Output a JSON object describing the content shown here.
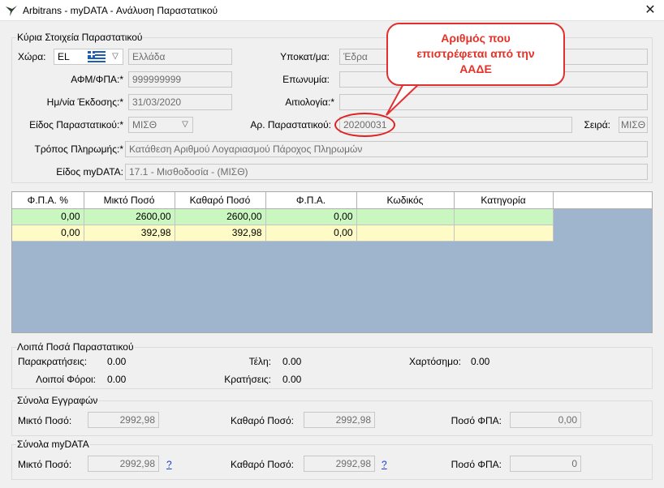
{
  "window": {
    "title": "Arbitrans - myDATA - Ανάλυση Παραστατικού",
    "close_glyph": "✕",
    "app_icon": "bird-logo-icon"
  },
  "main": {
    "group_title": "Κύρια Στοιχεία Παραστατικού",
    "country_label": "Χώρα:",
    "country_code": "EL",
    "country_name": "Ελλάδα",
    "afm_label": "ΑΦΜ/ΦΠΑ:*",
    "afm_value": "999999999",
    "issue_date_label": "Ημ/νία Έκδοσης:*",
    "issue_date_value": "31/03/2020",
    "doc_type_label": "Είδος Παραστατικού:*",
    "doc_type_value": "ΜΙΣΘ",
    "payment_label": "Τρόπος Πληρωμής:*",
    "payment_value": "Κατάθεση Αριθμού Λογαριασμού Πάροχος Πληρωμών",
    "mydata_type_label": "Είδος myDATA:",
    "mydata_type_value": "17.1 - Μισθοδοσία - (ΜΙΣΘ)",
    "branch_label": "Υποκατ/μα:",
    "branch_value": "Έδρα",
    "name_label": "Επωνυμία:",
    "name_value": "",
    "reason_label": "Αιτιολογία:*",
    "reason_value": "",
    "doc_number_label": "Αρ. Παραστατικού:",
    "doc_number_value": "20200031",
    "series_label": "Σειρά:",
    "series_value": "ΜΙΣΘ"
  },
  "callout": {
    "line1": "Αριθμός που",
    "line2": "επιστρέφεται από την",
    "line3": "ΑΑΔΕ",
    "color": "#e53228"
  },
  "grid": {
    "columns": [
      "Φ.Π.Α. %",
      "Μικτό Ποσό",
      "Καθαρό Ποσό",
      "Φ.Π.Α.",
      "Κωδικός",
      "Κατηγορία"
    ],
    "rows": [
      [
        "0,00",
        "2600,00",
        "2600,00",
        "0,00",
        "",
        ""
      ],
      [
        "0,00",
        "392,98",
        "392,98",
        "0,00",
        "",
        ""
      ]
    ],
    "row_colors": [
      "#c9f7bf",
      "#fefbc6"
    ],
    "background": "#9fb4cd"
  },
  "other_amounts": {
    "group_title": "Λοιπά Ποσά Παραστατικού",
    "withholdings_label": "Παρακρατήσεις:",
    "withholdings_value": "0.00",
    "fees_label": "Τέλη:",
    "fees_value": "0.00",
    "stamp_label": "Χαρτόσημο:",
    "stamp_value": "0.00",
    "other_taxes_label": "Λοιποί Φόροι:",
    "other_taxes_value": "0.00",
    "deductions_label": "Κρατήσεις:",
    "deductions_value": "0.00"
  },
  "totals_records": {
    "group_title": "Σύνολα Εγγραφών",
    "gross_label": "Μικτό Ποσό:",
    "gross_value": "2992,98",
    "net_label": "Καθαρό Ποσό:",
    "net_value": "2992,98",
    "vat_label": "Ποσό ΦΠΑ:",
    "vat_value": "0,00"
  },
  "totals_mydata": {
    "group_title": "Σύνολα myDATA",
    "gross_label": "Μικτό Ποσό:",
    "gross_value": "2992,98",
    "gross_help": "?",
    "net_label": "Καθαρό Ποσό:",
    "net_value": "2992,98",
    "net_help": "?",
    "vat_label": "Ποσό ΦΠΑ:",
    "vat_value": "0"
  }
}
